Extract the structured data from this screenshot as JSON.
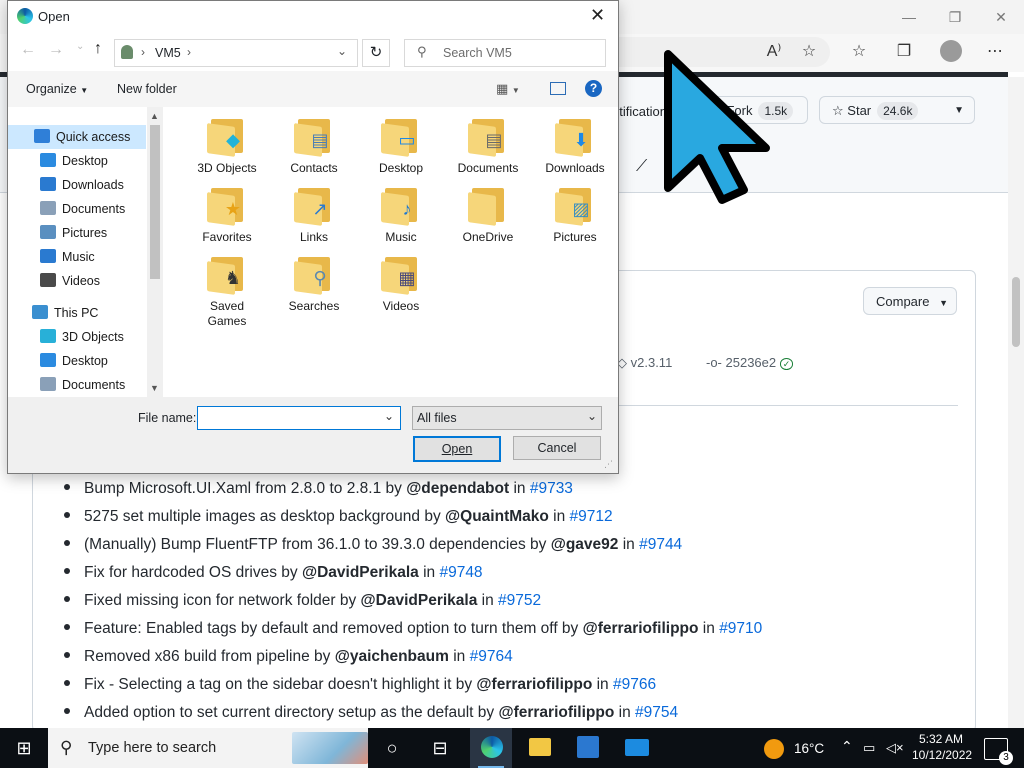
{
  "browser": {
    "window_controls": {
      "minimize": "—",
      "maximize": "❐",
      "close": "✕"
    },
    "toolbar_icons": [
      "read-aloud",
      "add-favorite",
      "favorites",
      "collections",
      "profile",
      "more"
    ]
  },
  "github": {
    "notifications_partial": "otifications",
    "fork_label": "Fork",
    "fork_count": "1.5k",
    "star_label": "Star",
    "star_count": "24.6k",
    "compare_label": "Compare",
    "tag": "v2.3.11",
    "commit": "25236e2",
    "notes": [
      {
        "text": "Bump Microsoft.UI.Xaml from 2.8.0 to 2.8.1 by ",
        "user": "@dependabot",
        "in": " in ",
        "link": "#9733"
      },
      {
        "text": "5275 set multiple images as desktop background by ",
        "user": "@QuaintMako",
        "in": " in ",
        "link": "#9712"
      },
      {
        "text": "(Manually) Bump FluentFTP from 36.1.0 to 39.3.0 dependencies by ",
        "user": "@gave92",
        "in": " in ",
        "link": "#9744"
      },
      {
        "text": "Fix for hardcoded OS drives by ",
        "user": "@DavidPerikala",
        "in": " in ",
        "link": "#9748"
      },
      {
        "text": "Fixed missing icon for network folder by ",
        "user": "@DavidPerikala",
        "in": " in ",
        "link": "#9752"
      },
      {
        "text": "Feature: Enabled tags by default and removed option to turn them off by ",
        "user": "@ferrariofilippo",
        "in": " in ",
        "link": "#9710"
      },
      {
        "text": "Removed x86 build from pipeline by ",
        "user": "@yaichenbaum",
        "in": " in ",
        "link": "#9764"
      },
      {
        "text": "Fix - Selecting a tag on the sidebar doesn't highlight it by ",
        "user": "@ferrariofilippo",
        "in": " in ",
        "link": "#9766"
      },
      {
        "text": "Added option to set current directory setup as the default by ",
        "user": "@ferrariofilippo",
        "in": " in ",
        "link": "#9754"
      }
    ]
  },
  "dialog": {
    "title": "Open",
    "breadcrumb": "VM5",
    "search_placeholder": "Search VM5",
    "organize_label": "Organize",
    "new_folder_label": "New folder",
    "nav": [
      {
        "label": "Quick access",
        "pinned": false
      },
      {
        "label": "Desktop",
        "pinned": true
      },
      {
        "label": "Downloads",
        "pinned": true
      },
      {
        "label": "Documents",
        "pinned": true
      },
      {
        "label": "Pictures",
        "pinned": true
      },
      {
        "label": "Music",
        "pinned": false
      },
      {
        "label": "Videos",
        "pinned": false
      },
      {
        "label": "This PC",
        "pinned": false
      },
      {
        "label": "3D Objects",
        "pinned": false
      },
      {
        "label": "Desktop",
        "pinned": false
      },
      {
        "label": "Documents",
        "pinned": false
      }
    ],
    "items": [
      {
        "label": "3D Objects",
        "icon": "cube-icon"
      },
      {
        "label": "Contacts",
        "icon": "contact-card-icon"
      },
      {
        "label": "Desktop",
        "icon": "monitor-icon"
      },
      {
        "label": "Documents",
        "icon": "document-icon"
      },
      {
        "label": "Downloads",
        "icon": "download-arrow-icon"
      },
      {
        "label": "Favorites",
        "icon": "star-icon"
      },
      {
        "label": "Links",
        "icon": "link-arrow-icon"
      },
      {
        "label": "Music",
        "icon": "music-note-icon"
      },
      {
        "label": "OneDrive",
        "icon": "folder-icon"
      },
      {
        "label": "Pictures",
        "icon": "picture-icon"
      },
      {
        "label": "Saved\nGames",
        "icon": "chess-icon"
      },
      {
        "label": "Searches",
        "icon": "magnifier-icon"
      },
      {
        "label": "Videos",
        "icon": "film-icon"
      }
    ],
    "filename_label": "File name:",
    "filename_value": "",
    "filter_value": "All files",
    "open_label": "Open",
    "cancel_label": "Cancel"
  },
  "taskbar": {
    "search_placeholder": "Type here to search",
    "weather": "16°C",
    "time": "5:32 AM",
    "date": "10/12/2022",
    "notification_count": "3"
  }
}
